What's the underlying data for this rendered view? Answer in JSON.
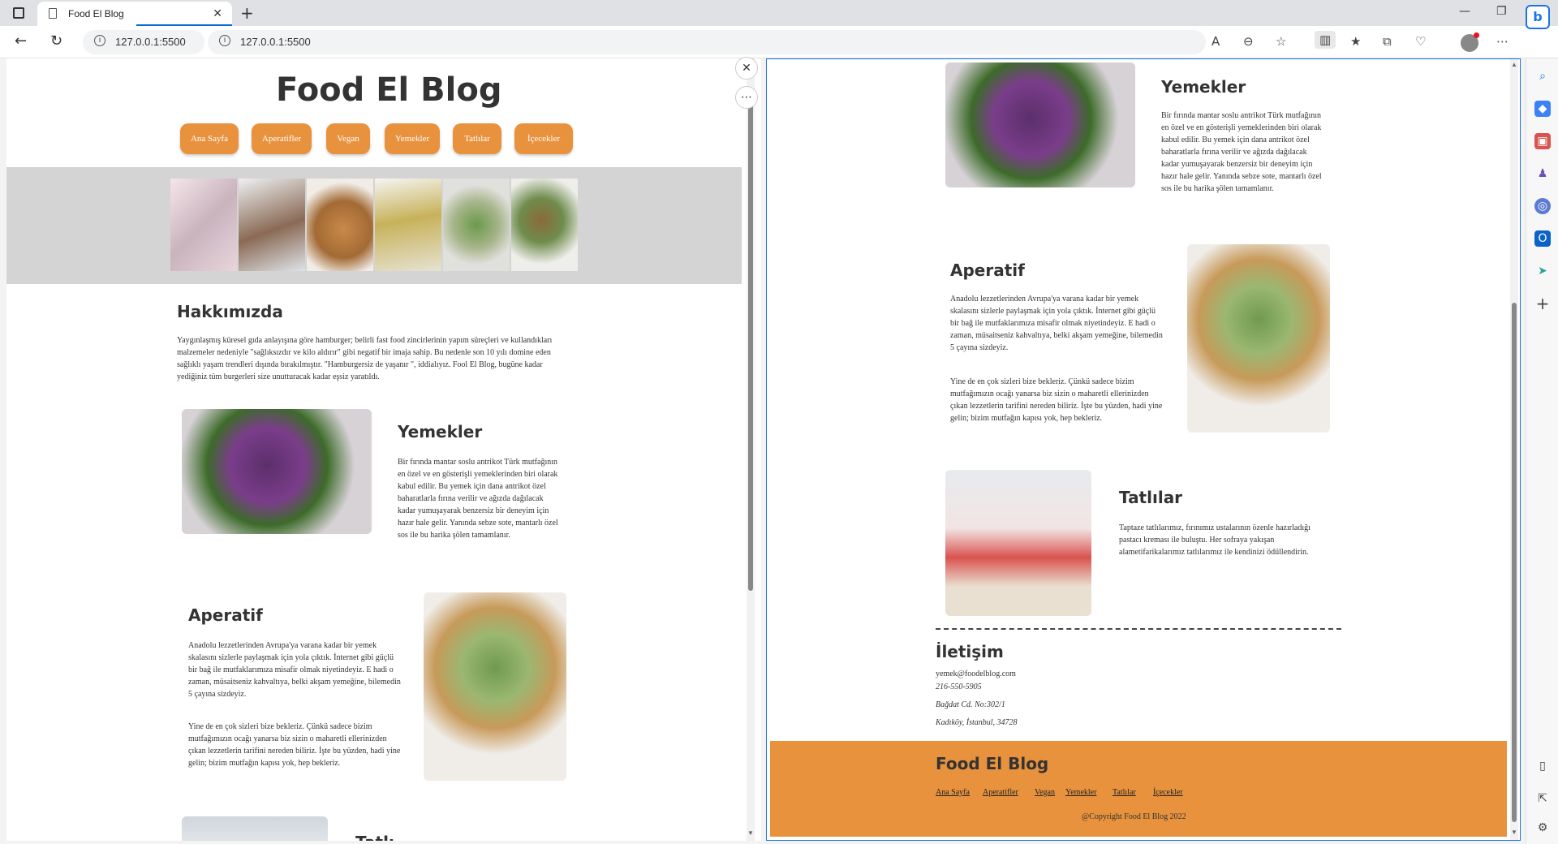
{
  "browser": {
    "tab_title": "Food El Blog",
    "url_left": "127.0.0.1:5500",
    "url_right": "127.0.0.1:5500",
    "tab_close": "✕",
    "new_tab": "+"
  },
  "site": {
    "title": "Food El Blog",
    "nav": [
      "Ana Sayfa",
      "Aperatifler",
      "Vegan",
      "Yemekler",
      "Tatlılar",
      "İçecekler"
    ],
    "about": {
      "heading": "Hakkımızda",
      "text": "Yaygınlaşmış küresel gıda anlayışına göre hamburger; belirli fast food zincirlerinin yapım süreçleri ve kullandıkları malzemeler nedeniyle \"sağlıksızdır ve kilo aldırır\" gibi negatif bir imaja sahip. Bu nedenle son 10 yılı domine eden sağlıklı yaşam trendleri dışında bırakılmıştır. \"Hamburgersiz de yaşanır \", iddialıyız. Fool El Blog, bugüne kadar yediğiniz tüm burgerleri size unutturacak kadar eşsiz yaratıldı."
    },
    "yemekler": {
      "heading": "Yemekler",
      "text": "Bir fırında mantar soslu antrikot Türk mutfağının en özel ve en gösterişli yemeklerinden biri olarak kabul edilir. Bu yemek için dana antrikot özel baharatlarla fırına verilir ve ağızda dağılacak kadar yumuşayarak benzersiz bir deneyim için hazır hale gelir. Yanında sebze sote, mantarlı özel sos ile bu harika şölen tamamlanır."
    },
    "aperatif": {
      "heading": "Aperatif",
      "text1": "Anadolu lezzetlerinden Avrupa'ya varana kadar bir yemek skalasını sizlerle paylaşmak için yola çıktık. İnternet gibi güçlü bir bağ ile mutfaklarımıza misafir olmak niyetindeyiz. E hadi o zaman, müsaitseniz kahvaltıya, belki akşam yemeğine, bilemedin 5 çayına sizdeyiz.",
      "text2": "Yine de en çok sizleri bize bekleriz. Çünkü sadece bizim mutfağımızın ocağı yanarsa biz sizin o maharetli ellerinizden çıkan lezzetlerin tarifini nereden biliriz. İşte bu yüzden, hadi yine gelin; bizim mutfağın kapısı yok, hep bekleriz."
    },
    "tatlilar": {
      "heading": "Tatlılar",
      "heading_partial": "Tatlı",
      "text": "Taptaze tatlılarımız, fırınımız ustalarının özenle hazırladığı pastacı kreması ile buluştu. Her sofraya yakışan alametifarikalarımız tatlılarımız ile kendinizi ödüllendirin."
    },
    "contact": {
      "heading": "İletişim",
      "email": "yemek@foodelblog.com",
      "phone": "216-550-5905",
      "address1": "Bağdat Cd. No:302/1",
      "address2": "Kadıköy, İstanbul, 34728"
    },
    "footer": {
      "title": "Food El Blog",
      "links": [
        "Ana Sayfa",
        "Aperatifler",
        "Vegan",
        "Yemekler",
        "Tatlılar",
        "İçecekler"
      ],
      "copyright": "@Copyright Food El Blog 2022"
    }
  },
  "colors": {
    "accent": "#e8923e",
    "gallery_bg": "#d4d4d4",
    "text": "#333333"
  }
}
